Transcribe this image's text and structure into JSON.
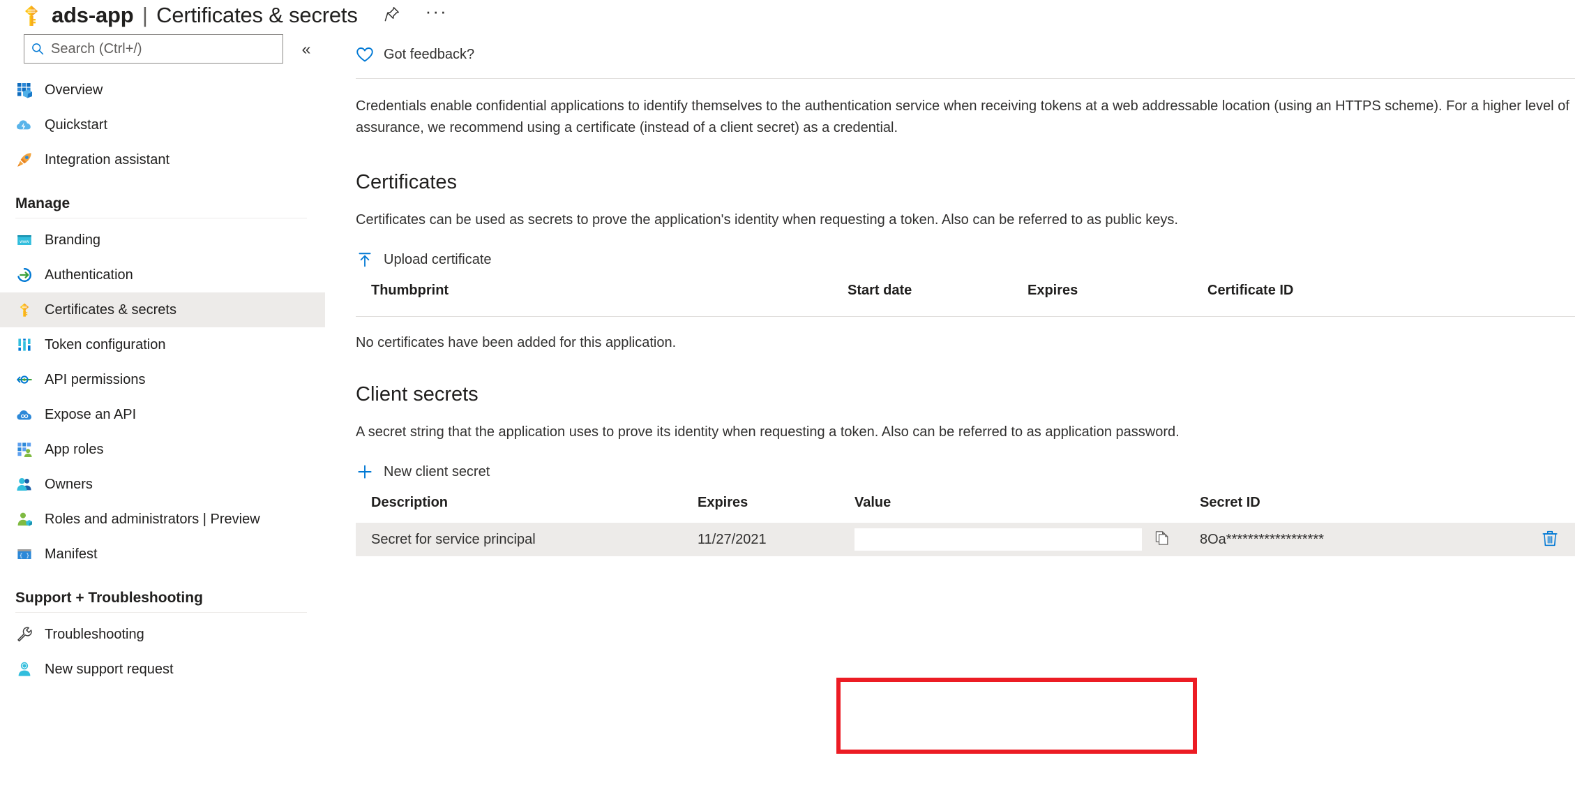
{
  "header": {
    "app_name": "ads-app",
    "separator": "|",
    "page_name": "Certificates & secrets",
    "pin_icon": "pin-icon",
    "more_label": "···"
  },
  "sidebar": {
    "search": {
      "placeholder": "Search (Ctrl+/)",
      "value": "",
      "icon": "search-icon"
    },
    "collapse_label": "«",
    "top_items": [
      {
        "label": "Overview",
        "icon": "overview-icon"
      },
      {
        "label": "Quickstart",
        "icon": "quickstart-icon"
      },
      {
        "label": "Integration assistant",
        "icon": "rocket-icon"
      }
    ],
    "groups": [
      {
        "title": "Manage",
        "items": [
          {
            "label": "Branding",
            "icon": "branding-icon"
          },
          {
            "label": "Authentication",
            "icon": "authentication-icon"
          },
          {
            "label": "Certificates & secrets",
            "icon": "key-icon",
            "selected": true
          },
          {
            "label": "Token configuration",
            "icon": "token-icon"
          },
          {
            "label": "API permissions",
            "icon": "api-permissions-icon"
          },
          {
            "label": "Expose an API",
            "icon": "expose-api-icon"
          },
          {
            "label": "App roles",
            "icon": "app-roles-icon"
          },
          {
            "label": "Owners",
            "icon": "owners-icon"
          },
          {
            "label": "Roles and administrators | Preview",
            "icon": "roles-admin-icon"
          },
          {
            "label": "Manifest",
            "icon": "manifest-icon"
          }
        ]
      },
      {
        "title": "Support + Troubleshooting",
        "items": [
          {
            "label": "Troubleshooting",
            "icon": "wrench-icon"
          },
          {
            "label": "New support request",
            "icon": "support-person-icon"
          }
        ]
      }
    ]
  },
  "main": {
    "feedback": {
      "label": "Got feedback?",
      "icon": "heart-icon"
    },
    "intro": "Credentials enable confidential applications to identify themselves to the authentication service when receiving tokens at a web addressable location (using an HTTPS scheme). For a higher level of assurance, we recommend using a certificate (instead of a client secret) as a credential.",
    "certificates": {
      "title": "Certificates",
      "description": "Certificates can be used as secrets to prove the application's identity when requesting a token. Also can be referred to as public keys.",
      "upload_label": "Upload certificate",
      "upload_icon": "upload-arrow-icon",
      "columns": [
        "Thumbprint",
        "Start date",
        "Expires",
        "Certificate ID"
      ],
      "rows": [],
      "empty_message": "No certificates have been added for this application."
    },
    "client_secrets": {
      "title": "Client secrets",
      "description": "A secret string that the application uses to prove its identity when requesting a token. Also can be referred to as application password.",
      "new_secret_label": "New client secret",
      "new_secret_icon": "plus-icon",
      "columns": [
        "Description",
        "Expires",
        "Value",
        "Secret ID"
      ],
      "rows": [
        {
          "description": "Secret for service principal",
          "expires": "11/27/2021",
          "value": "",
          "value_placeholder": "",
          "copy_icon": "copy-icon",
          "secret_id": "8Oa******************",
          "delete_icon": "trash-icon"
        }
      ]
    }
  },
  "annotation": {
    "color": "#ec1c24",
    "target": "client-secret-value-cell"
  }
}
